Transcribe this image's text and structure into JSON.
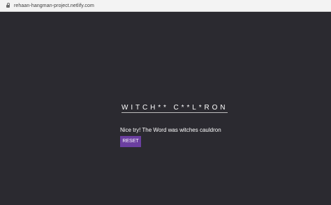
{
  "browser": {
    "url": "rehaan-hangman-project.netlify.com",
    "lock_icon": "lock-icon"
  },
  "game": {
    "word_display": "WITCH** C**L*RON",
    "message": "Nice try! The Word was witches cauldron",
    "reset_label": "RESET"
  },
  "colors": {
    "background": "#2b2a30",
    "button": "#6b3fa0",
    "text": "#ffffff"
  }
}
